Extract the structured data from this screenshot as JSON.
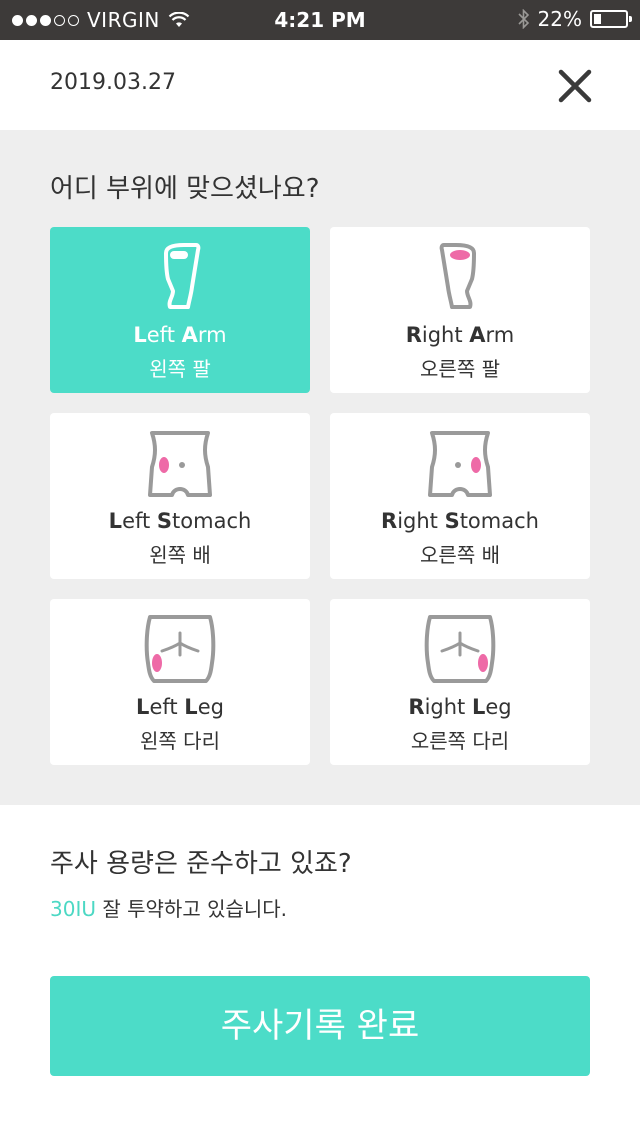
{
  "status_bar": {
    "carrier": "VIRGIN",
    "time": "4:21 PM",
    "battery": "22%",
    "battery_level": 0.22,
    "signal_bars": 3,
    "signal_total": 5
  },
  "header": {
    "date": "2019.03.27",
    "close_icon": "close-icon"
  },
  "site_question": "어디 부위에 맞으셨나요?",
  "sites": [
    {
      "en_first": "L",
      "en_first_rest": "eft ",
      "en_second": "A",
      "en_second_rest": "rm",
      "ko": "왼쪽 팔",
      "selected": true,
      "icon": "left-arm-icon"
    },
    {
      "en_first": "R",
      "en_first_rest": "ight ",
      "en_second": "A",
      "en_second_rest": "rm",
      "ko": "오른쪽 팔",
      "selected": false,
      "icon": "right-arm-icon"
    },
    {
      "en_first": "L",
      "en_first_rest": "eft ",
      "en_second": "S",
      "en_second_rest": "tomach",
      "ko": "왼쪽 배",
      "selected": false,
      "icon": "left-stomach-icon"
    },
    {
      "en_first": "R",
      "en_first_rest": "ight ",
      "en_second": "S",
      "en_second_rest": "tomach",
      "ko": "오른쪽 배",
      "selected": false,
      "icon": "right-stomach-icon"
    },
    {
      "en_first": "L",
      "en_first_rest": "eft ",
      "en_second": "L",
      "en_second_rest": "eg",
      "ko": "왼쪽 다리",
      "selected": false,
      "icon": "left-leg-icon"
    },
    {
      "en_first": "R",
      "en_first_rest": "ight ",
      "en_second": "L",
      "en_second_rest": "eg",
      "ko": "오른쪽 다리",
      "selected": false,
      "icon": "right-leg-icon"
    }
  ],
  "dose": {
    "question": "주사 용량은 준수하고 있죠?",
    "amount": "30IU",
    "text": " 잘 투약하고 있습니다."
  },
  "submit_label": "주사기록 완료",
  "colors": {
    "accent": "#4cdcc8",
    "marker": "#ee6aa7",
    "status_bar": "#3d3a39",
    "background": "#eeeeee"
  }
}
